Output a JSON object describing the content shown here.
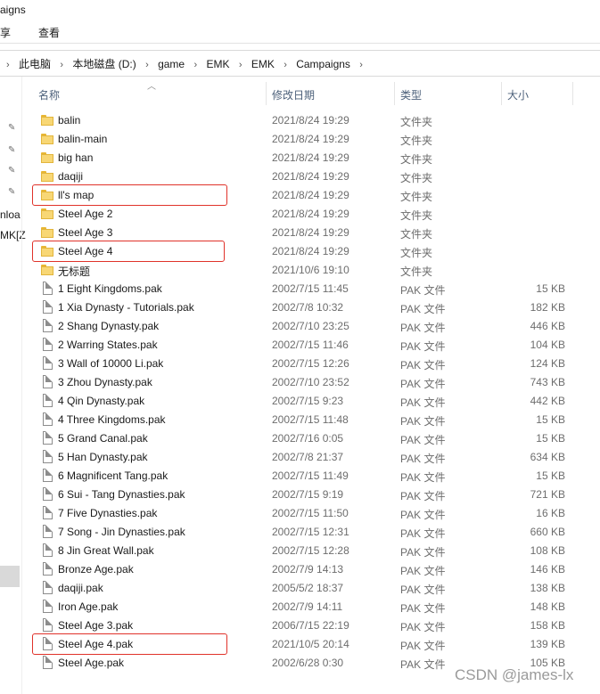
{
  "window": {
    "title_fragment": "aigns",
    "ribbon": {
      "share_fragment": "享",
      "view": "查看"
    }
  },
  "address": {
    "crumbs": [
      "此电脑",
      "本地磁盘 (D:)",
      "game",
      "EMK",
      "EMK",
      "Campaigns"
    ],
    "separator": "›",
    "back_fragment": "›"
  },
  "nav": {
    "fragments": [
      "nloa",
      "MK[Z"
    ]
  },
  "columns": {
    "name": "名称",
    "date": "修改日期",
    "type": "类型",
    "size": "大小"
  },
  "files": [
    {
      "name": "balin",
      "date": "2021/8/24 19:29",
      "type": "文件夹",
      "size": "",
      "kind": "folder"
    },
    {
      "name": "balin-main",
      "date": "2021/8/24 19:29",
      "type": "文件夹",
      "size": "",
      "kind": "folder"
    },
    {
      "name": "big han",
      "date": "2021/8/24 19:29",
      "type": "文件夹",
      "size": "",
      "kind": "folder"
    },
    {
      "name": "daqiji",
      "date": "2021/8/24 19:29",
      "type": "文件夹",
      "size": "",
      "kind": "folder"
    },
    {
      "name": "ll's map",
      "date": "2021/8/24 19:29",
      "type": "文件夹",
      "size": "",
      "kind": "folder",
      "highlighted": true
    },
    {
      "name": "Steel Age 2",
      "date": "2021/8/24 19:29",
      "type": "文件夹",
      "size": "",
      "kind": "folder"
    },
    {
      "name": "Steel Age 3",
      "date": "2021/8/24 19:29",
      "type": "文件夹",
      "size": "",
      "kind": "folder"
    },
    {
      "name": "Steel Age 4",
      "date": "2021/8/24 19:29",
      "type": "文件夹",
      "size": "",
      "kind": "folder",
      "highlighted": true
    },
    {
      "name": "无标题",
      "date": "2021/10/6 19:10",
      "type": "文件夹",
      "size": "",
      "kind": "folder"
    },
    {
      "name": "1 Eight Kingdoms.pak",
      "date": "2002/7/15 11:45",
      "type": "PAK 文件",
      "size": "15 KB",
      "kind": "file"
    },
    {
      "name": "1 Xia Dynasty - Tutorials.pak",
      "date": "2002/7/8 10:32",
      "type": "PAK 文件",
      "size": "182 KB",
      "kind": "file"
    },
    {
      "name": "2 Shang Dynasty.pak",
      "date": "2002/7/10 23:25",
      "type": "PAK 文件",
      "size": "446 KB",
      "kind": "file"
    },
    {
      "name": "2 Warring States.pak",
      "date": "2002/7/15 11:46",
      "type": "PAK 文件",
      "size": "104 KB",
      "kind": "file"
    },
    {
      "name": "3 Wall of 10000 Li.pak",
      "date": "2002/7/15 12:26",
      "type": "PAK 文件",
      "size": "124 KB",
      "kind": "file"
    },
    {
      "name": "3 Zhou Dynasty.pak",
      "date": "2002/7/10 23:52",
      "type": "PAK 文件",
      "size": "743 KB",
      "kind": "file"
    },
    {
      "name": "4 Qin Dynasty.pak",
      "date": "2002/7/15 9:23",
      "type": "PAK 文件",
      "size": "442 KB",
      "kind": "file"
    },
    {
      "name": "4 Three Kingdoms.pak",
      "date": "2002/7/15 11:48",
      "type": "PAK 文件",
      "size": "15 KB",
      "kind": "file"
    },
    {
      "name": "5 Grand Canal.pak",
      "date": "2002/7/16 0:05",
      "type": "PAK 文件",
      "size": "15 KB",
      "kind": "file"
    },
    {
      "name": "5 Han Dynasty.pak",
      "date": "2002/7/8 21:37",
      "type": "PAK 文件",
      "size": "634 KB",
      "kind": "file"
    },
    {
      "name": "6 Magnificent Tang.pak",
      "date": "2002/7/15 11:49",
      "type": "PAK 文件",
      "size": "15 KB",
      "kind": "file"
    },
    {
      "name": "6 Sui - Tang Dynasties.pak",
      "date": "2002/7/15 9:19",
      "type": "PAK 文件",
      "size": "721 KB",
      "kind": "file"
    },
    {
      "name": "7 Five Dynasties.pak",
      "date": "2002/7/15 11:50",
      "type": "PAK 文件",
      "size": "16 KB",
      "kind": "file"
    },
    {
      "name": "7 Song - Jin  Dynasties.pak",
      "date": "2002/7/15 12:31",
      "type": "PAK 文件",
      "size": "660 KB",
      "kind": "file"
    },
    {
      "name": "8 Jin Great Wall.pak",
      "date": "2002/7/15 12:28",
      "type": "PAK 文件",
      "size": "108 KB",
      "kind": "file"
    },
    {
      "name": "Bronze Age.pak",
      "date": "2002/7/9 14:13",
      "type": "PAK 文件",
      "size": "146 KB",
      "kind": "file"
    },
    {
      "name": "daqiji.pak",
      "date": "2005/5/2 18:37",
      "type": "PAK 文件",
      "size": "138 KB",
      "kind": "file"
    },
    {
      "name": "Iron Age.pak",
      "date": "2002/7/9 14:11",
      "type": "PAK 文件",
      "size": "148 KB",
      "kind": "file"
    },
    {
      "name": "Steel Age 3.pak",
      "date": "2006/7/15 22:19",
      "type": "PAK 文件",
      "size": "158 KB",
      "kind": "file"
    },
    {
      "name": "Steel Age 4.pak",
      "date": "2021/10/5 20:14",
      "type": "PAK 文件",
      "size": "139 KB",
      "kind": "file",
      "highlighted": true
    },
    {
      "name": "Steel Age.pak",
      "date": "2002/6/28 0:30",
      "type": "PAK 文件",
      "size": "105 KB",
      "kind": "file"
    }
  ],
  "watermark": "CSDN @james-lx",
  "colors": {
    "highlight": "#e0322a",
    "folder": "#f8d775",
    "header_text": "#4c607a"
  }
}
